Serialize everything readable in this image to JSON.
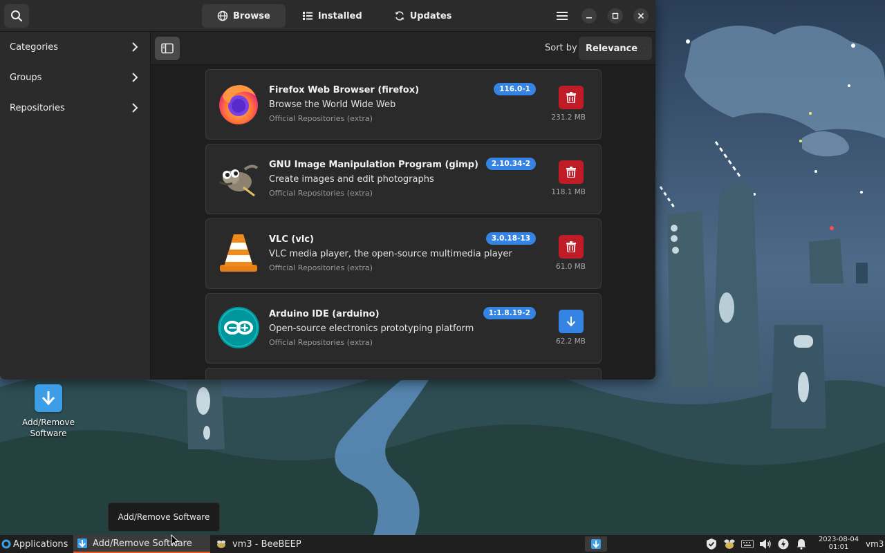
{
  "window": {
    "tabs": [
      {
        "label": "Browse",
        "icon": "globe-icon",
        "active": true
      },
      {
        "label": "Installed",
        "icon": "list-icon",
        "active": false
      },
      {
        "label": "Updates",
        "icon": "refresh-icon",
        "active": false
      }
    ]
  },
  "sidebar": {
    "items": [
      {
        "label": "Categories"
      },
      {
        "label": "Groups"
      },
      {
        "label": "Repositories"
      }
    ]
  },
  "toolbar": {
    "sort_label": "Sort by",
    "sort_value": "Relevance"
  },
  "packages": [
    {
      "name": "Firefox Web Browser (firefox)",
      "description": "Browse the World Wide Web",
      "repository": "Official Repositories (extra)",
      "version": "116.0-1",
      "size": "231.2 MB",
      "action": "remove"
    },
    {
      "name": "GNU Image Manipulation Program (gimp)",
      "description": "Create images and edit photographs",
      "repository": "Official Repositories (extra)",
      "version": "2.10.34-2",
      "size": "118.1 MB",
      "action": "remove"
    },
    {
      "name": "VLC (vlc)",
      "description": "VLC media player, the open-source multimedia player",
      "repository": "Official Repositories (extra)",
      "version": "3.0.18-13",
      "size": "61.0 MB",
      "action": "remove"
    },
    {
      "name": "Arduino IDE (arduino)",
      "description": "Open-source electronics prototyping platform",
      "repository": "Official Repositories (extra)",
      "version": "1:1.8.19-2",
      "size": "62.2 MB",
      "action": "install"
    }
  ],
  "desktop": {
    "icon_label_line1": "Add/Remove",
    "icon_label_line2": "Software",
    "tooltip": "Add/Remove Software"
  },
  "taskbar": {
    "apps_label": "Applications",
    "tasks": [
      {
        "label": "Add/Remove Software",
        "active": true
      },
      {
        "label": "vm3 - BeeBEEP",
        "active": false
      }
    ],
    "date": "2023-08-04",
    "time": "01:01",
    "user": "vm3"
  },
  "colors": {
    "accent": "#3584e4",
    "remove": "#c01c28",
    "taskbar_active_underline": "#e35a2b"
  }
}
